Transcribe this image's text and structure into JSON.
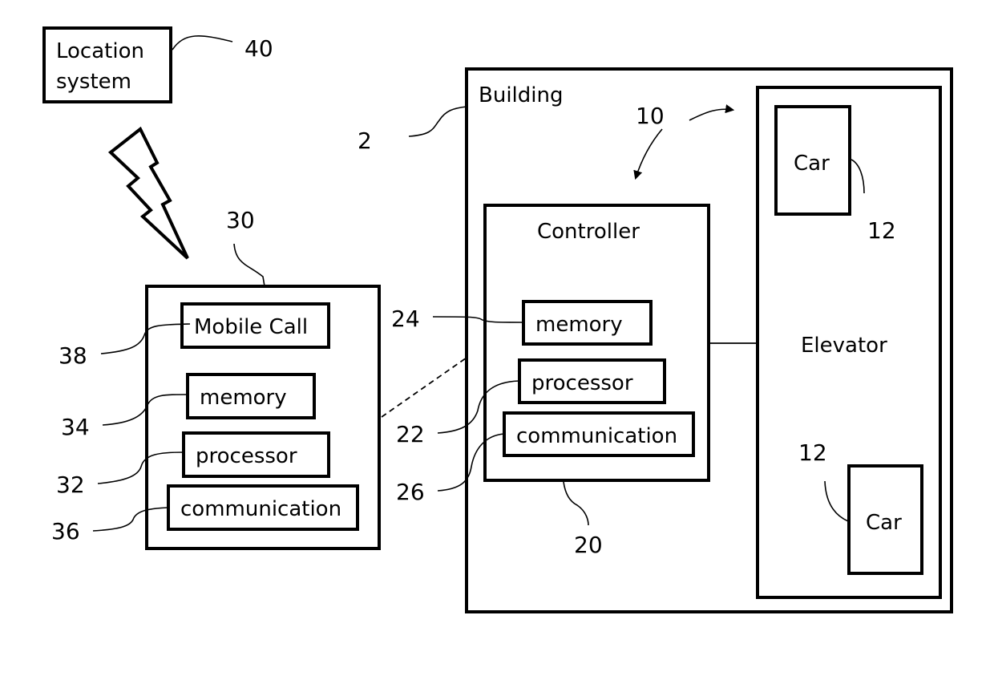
{
  "diagram": {
    "location_system": {
      "line1": "Location",
      "line2": "system",
      "ref": "40"
    },
    "mobile_device": {
      "ref": "30",
      "components": [
        {
          "label": "Mobile Call",
          "ref": "38"
        },
        {
          "label": "memory",
          "ref": "34"
        },
        {
          "label": "processor",
          "ref": "32"
        },
        {
          "label": "communication",
          "ref": "36"
        }
      ]
    },
    "building": {
      "label": "Building",
      "ref": "2",
      "system_ref": "10",
      "controller": {
        "label": "Controller",
        "ref": "20",
        "components": [
          {
            "label": "memory",
            "ref": "24"
          },
          {
            "label": "processor",
            "ref": "22"
          },
          {
            "label": "communication",
            "ref": "26"
          }
        ]
      },
      "elevator": {
        "label": "Elevator",
        "cars": [
          {
            "label": "Car",
            "ref": "12"
          },
          {
            "label": "Car",
            "ref": "12"
          }
        ]
      }
    },
    "icons": {
      "wireless": "lightning-bolt-icon"
    }
  }
}
